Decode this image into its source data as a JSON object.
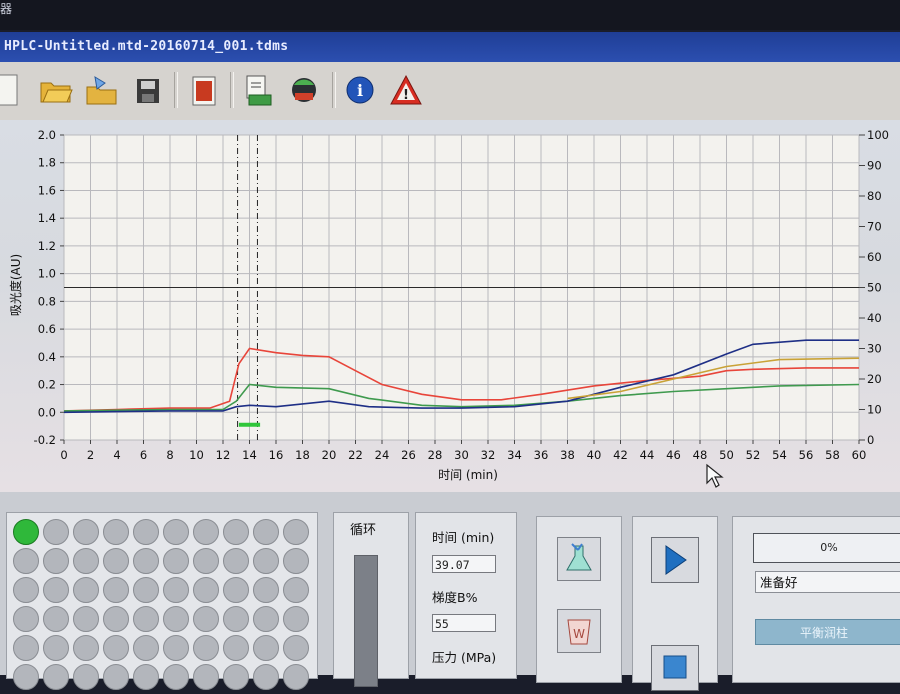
{
  "top_strip": {
    "text": "器"
  },
  "window": {
    "title": "HPLC-Untitled.mtd-20160714_001.tdms"
  },
  "toolbar": {
    "buttons": [
      {
        "name": "new-file-icon"
      },
      {
        "name": "open-folder-icon"
      },
      {
        "name": "open-method-icon"
      },
      {
        "name": "save-icon"
      },
      {
        "name": "report-icon"
      },
      {
        "name": "export-icon"
      },
      {
        "name": "instrument-icon"
      },
      {
        "name": "info-icon"
      },
      {
        "name": "warning-icon"
      }
    ]
  },
  "chart_data": {
    "type": "line",
    "ylabel": "吸光度(AU)",
    "xlabel": "时间 (min)",
    "xlim": [
      0,
      60
    ],
    "ylim": [
      -0.2,
      2.0
    ],
    "y2lim": [
      0,
      100
    ],
    "x_ticks": [
      "0",
      "2",
      "4",
      "6",
      "8",
      "10",
      "12",
      "14",
      "16",
      "18",
      "20",
      "22",
      "24",
      "26",
      "28",
      "30",
      "32",
      "34",
      "36",
      "38",
      "40",
      "42",
      "44",
      "46",
      "48",
      "50",
      "52",
      "54",
      "56",
      "58",
      "60"
    ],
    "y_ticks": [
      "2.0",
      "1.8",
      "1.6",
      "1.4",
      "1.2",
      "1.0",
      "0.8",
      "0.6",
      "0.4",
      "0.2",
      "0.0",
      "-0.2"
    ],
    "y2_ticks": [
      "100",
      "90",
      "80",
      "70",
      "60",
      "50",
      "40",
      "30",
      "20",
      "10",
      "0"
    ],
    "grid": true,
    "reference_line_y2": 50,
    "markers_x": [
      13.1,
      14.6
    ],
    "green_mark": {
      "x": [
        13.2,
        14.8
      ],
      "y": -0.09
    },
    "series": [
      {
        "color": "#e8453a",
        "x": [
          0,
          4,
          8,
          11,
          12.5,
          13.2,
          14,
          16,
          18,
          20,
          22,
          24,
          27,
          30,
          33,
          36,
          40,
          44,
          48,
          50,
          52,
          56,
          60
        ],
        "y": [
          0.01,
          0.02,
          0.03,
          0.03,
          0.08,
          0.35,
          0.46,
          0.43,
          0.41,
          0.4,
          0.3,
          0.2,
          0.13,
          0.09,
          0.09,
          0.13,
          0.19,
          0.23,
          0.26,
          0.3,
          0.31,
          0.32,
          0.32
        ]
      },
      {
        "color": "#3f9a4e",
        "x": [
          0,
          8,
          12,
          13,
          14,
          16,
          20,
          23,
          27,
          30,
          34,
          38,
          42,
          46,
          50,
          54,
          60
        ],
        "y": [
          0.01,
          0.02,
          0.02,
          0.08,
          0.2,
          0.18,
          0.17,
          0.1,
          0.05,
          0.04,
          0.05,
          0.08,
          0.12,
          0.15,
          0.17,
          0.19,
          0.2
        ]
      },
      {
        "color": "#1e2f86",
        "x": [
          0,
          8,
          12,
          13,
          14,
          16,
          20,
          23,
          27,
          30,
          34,
          38,
          42,
          46,
          50,
          52,
          56,
          60
        ],
        "y": [
          0.0,
          0.01,
          0.01,
          0.04,
          0.05,
          0.04,
          0.08,
          0.04,
          0.03,
          0.03,
          0.04,
          0.08,
          0.18,
          0.27,
          0.42,
          0.49,
          0.52,
          0.52
        ]
      },
      {
        "color": "#c9a236",
        "x": [
          38,
          42,
          46,
          50,
          54,
          60
        ],
        "y": [
          0.1,
          0.15,
          0.24,
          0.33,
          0.38,
          0.39
        ]
      }
    ]
  },
  "plate": {
    "rows": 6,
    "cols": 10,
    "active_well": 0
  },
  "loop": {
    "label": "循环"
  },
  "params": {
    "time_label": "时间 (min)",
    "time_value": "39.07",
    "gradient_label": "梯度B%",
    "gradient_value": "55",
    "pressure_label": "压力 (MPa)"
  },
  "status": {
    "progress_text": "0%",
    "state": "准备好",
    "equilibrate_button": "平衡润柱"
  }
}
